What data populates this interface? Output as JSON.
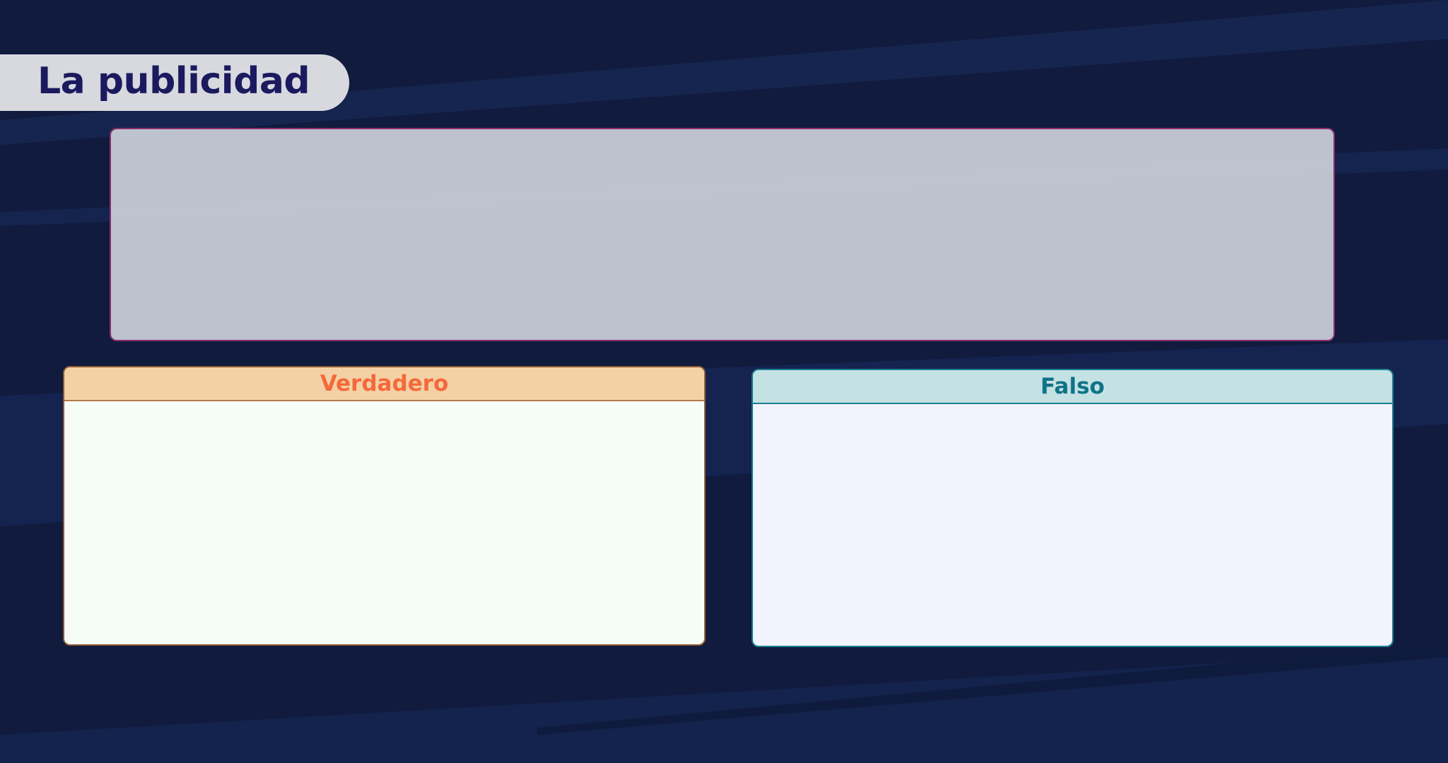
{
  "slide": {
    "title": "La publicidad"
  },
  "panels": {
    "true_label": "Verdadero",
    "false_label": "Falso"
  },
  "colors": {
    "background": "#101b3d",
    "stripe": "#16254f",
    "title_text": "#1b1a5e",
    "true_header_text": "#f4693b",
    "false_header_text": "#0f7388"
  }
}
